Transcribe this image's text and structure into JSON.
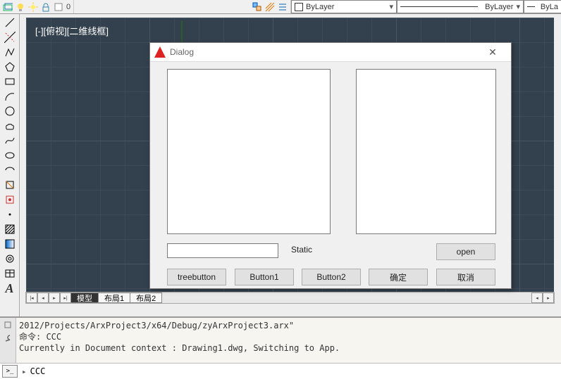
{
  "topbar": {
    "dd_layer": "ByLayer",
    "dd_linetype": "ByLayer",
    "dd_lweight": "ByLa"
  },
  "left_tools": [
    "line-icon",
    "polyline-icon",
    "ray-icon",
    "arc-icon",
    "polygon-icon",
    "rectangle-icon",
    "circle-icon",
    "spline-icon",
    "ellipse-icon",
    "ellipse-arc-icon",
    "cloud-icon",
    "donut-icon",
    "point-icon",
    "wipeout-icon",
    "hatch-icon",
    "gradient-icon",
    "region-icon",
    "table-icon",
    "mtext-icon"
  ],
  "viewport_label": "[-][俯视][二维线框]",
  "tabs": {
    "model": "模型",
    "layout1": "布局1",
    "layout2": "布局2"
  },
  "dialog": {
    "title": "Dialog",
    "static_label": "Static",
    "btn_open": "open",
    "btn_tree": "treebutton",
    "btn_b1": "Button1",
    "btn_b2": "Button2",
    "btn_ok": "确定",
    "btn_cancel": "取消"
  },
  "console_text": "2012/Projects/ArxProject3/x64/Debug/zyArxProject3.arx\"\n命令: CCC\nCurrently in Document context : Drawing1.dwg, Switching to App.",
  "cmdline": {
    "prompt": ">_",
    "chevron": "▸",
    "text": "CCC"
  }
}
